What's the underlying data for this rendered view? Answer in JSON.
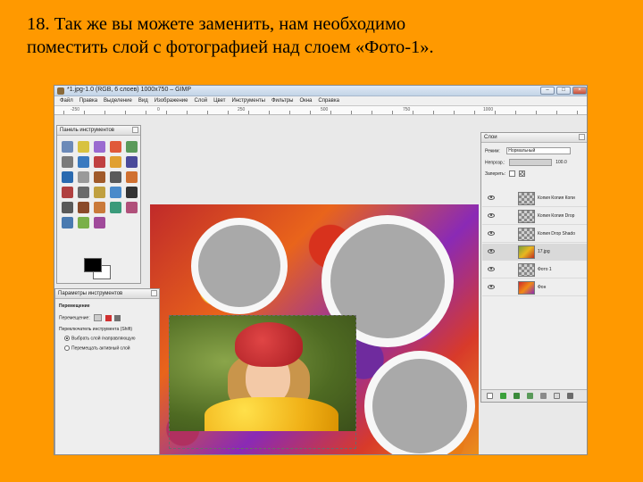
{
  "caption": {
    "line1": "18. Так же вы можете заменить, нам необходимо",
    "line2": "поместить слой с фотографией над слоем «Фото-1»."
  },
  "window": {
    "title": "*1.jpg-1.0 (RGB, 6 слоев) 1000x750 – GIMP",
    "buttons": {
      "minimize": "–",
      "maximize": "□",
      "close": "×"
    }
  },
  "menu": [
    "Файл",
    "Правка",
    "Выделение",
    "Вид",
    "Изображение",
    "Слой",
    "Цвет",
    "Инструменты",
    "Фильтры",
    "Окна",
    "Справка"
  ],
  "ruler": [
    "-250",
    "0",
    "250",
    "500",
    "750",
    "1000"
  ],
  "toolbox": {
    "title": "Панель инструментов",
    "tool_colors": [
      "#6c8ab8",
      "#d8c240",
      "#9a6ad0",
      "#e05a3a",
      "#5a9a5a",
      "#7a7a7a",
      "#3a7ac0",
      "#c04040",
      "#e0a030",
      "#4a4a9a",
      "#2a6ab0",
      "#9a9a9a",
      "#a05a2a",
      "#5a5a5a",
      "#d07030",
      "#b04040",
      "#6a6a6a",
      "#c0a040",
      "#4a8aca",
      "#333333",
      "#5a5a5a",
      "#8a4a2a",
      "#ca7a3a",
      "#3a9a7a",
      "#b0507a",
      "#4a7ab0",
      "#7ab04a",
      "#a04a9a"
    ]
  },
  "tool_options": {
    "title": "Параметры инструментов",
    "section": "Перемещение",
    "move_label": "Перемещение:",
    "toggle_label": "Переключатель инструмента (Shift)",
    "option1": "Выбрать слой /направляющую",
    "option2": "Перемещать активный слой"
  },
  "layers": {
    "title": "Слои",
    "mode_label": "Режим:",
    "mode_value": "Нормальный",
    "opacity_label": "Непрозр.:",
    "opacity_value": "100.0",
    "lock_label": "Запереть:",
    "items": [
      {
        "name": "Копия Копия Копи"
      },
      {
        "name": "Копия Копия Drop"
      },
      {
        "name": "Копия Drop Shado"
      },
      {
        "name": "17.jpg"
      },
      {
        "name": "Фото 1"
      },
      {
        "name": "Фон"
      }
    ]
  }
}
